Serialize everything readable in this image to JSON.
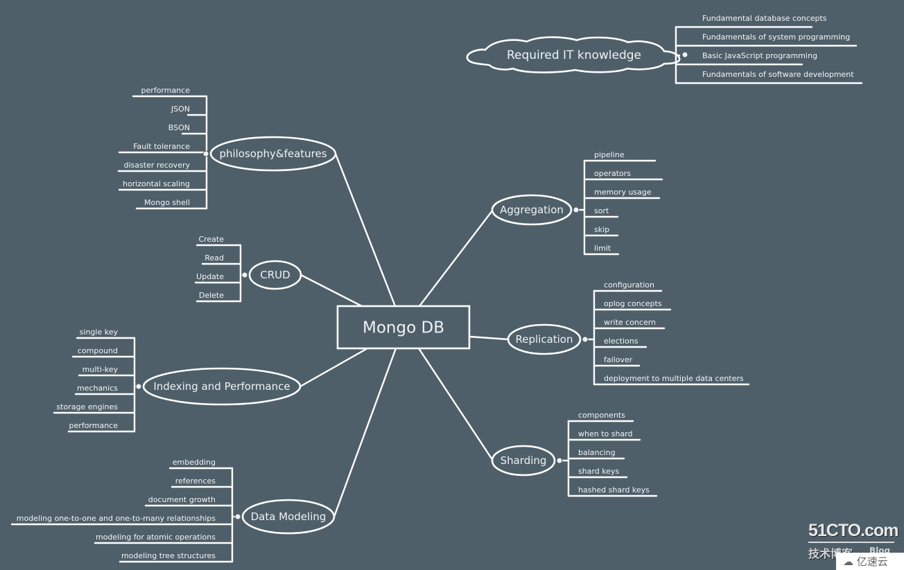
{
  "canvas": {
    "background": "#4f5f69",
    "line_color": "#ffffff"
  },
  "central_topic": {
    "label": "Mongo DB"
  },
  "floating_topic": {
    "label": "Required IT knowledge",
    "shape": "cloud",
    "children": [
      "Fundamental database concepts",
      "Fundamentals of system programming",
      "Basic JavaScript programming",
      "Fundamentals of software development"
    ]
  },
  "topics": [
    {
      "id": "philosophy",
      "label": "philosophy&features",
      "side": "left",
      "children": [
        "performance",
        "JSON",
        "BSON",
        "Fault tolerance",
        "disaster recovery",
        "horizontal scaling",
        "Mongo shell"
      ]
    },
    {
      "id": "crud",
      "label": "CRUD",
      "side": "left",
      "children": [
        "Create",
        "Read",
        "Update",
        "Delete"
      ]
    },
    {
      "id": "indexing",
      "label": "Indexing and Performance",
      "side": "left",
      "children": [
        "single key",
        "compound",
        "multi-key",
        "mechanics",
        "storage engines",
        "performance"
      ]
    },
    {
      "id": "datamodeling",
      "label": "Data Modeling",
      "side": "left",
      "children": [
        "embedding",
        "references",
        "document growth",
        "modeling one-to-one and one-to-many relationships",
        "modeling for atomic operations",
        "modeling tree structures"
      ]
    },
    {
      "id": "aggregation",
      "label": "Aggregation",
      "side": "right",
      "children": [
        "pipeline",
        "operators",
        "memory usage",
        "sort",
        "skip",
        "limit"
      ]
    },
    {
      "id": "replication",
      "label": "Replication",
      "side": "right",
      "children": [
        "configuration",
        "oplog concepts",
        "write concern",
        "elections",
        "failover",
        "deployment to multiple data centers"
      ]
    },
    {
      "id": "sharding",
      "label": "Sharding",
      "side": "right",
      "children": [
        "components",
        "when to shard",
        "balancing",
        "shard keys",
        "hashed shard keys"
      ]
    }
  ],
  "watermark": {
    "site": "51CTO.com",
    "subtitle_cn": "技术博客",
    "subtitle_en": "Blog",
    "badge": "亿速云"
  }
}
